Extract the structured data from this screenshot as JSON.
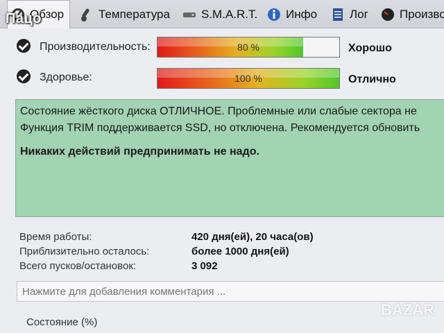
{
  "watermark": "Пацо",
  "tabs": [
    {
      "label": "Обзор",
      "icon": "gauge-icon"
    },
    {
      "label": "Температура",
      "icon": "thermometer-icon"
    },
    {
      "label": "S.M.A.R.T.",
      "icon": "drive-icon"
    },
    {
      "label": "Инфо",
      "icon": "info-icon"
    },
    {
      "label": "Лог",
      "icon": "document-icon"
    },
    {
      "label": "Произво",
      "icon": "speedometer-icon"
    }
  ],
  "status": {
    "performance": {
      "label": "Производительность:",
      "percent": 80,
      "percent_text": "80 %",
      "verdict": "Хорошо"
    },
    "health": {
      "label": "Здоровье:",
      "percent": 100,
      "percent_text": "100 %",
      "verdict": "Отлично"
    }
  },
  "message": {
    "line1": "Состояние жёсткого диска ОТЛИЧНОЕ. Проблемные или слабые сектора не",
    "line2": "Функция TRIM поддерживается SSD, но отключена. Рекомендуется обновить",
    "advice": "Никаких действий предпринимать не надо."
  },
  "info": {
    "uptime": {
      "label": "Время работы:",
      "value": "420 дня(ей), 20 часа(ов)"
    },
    "remaining": {
      "label": "Приблизительно осталось:",
      "value": "более 1000 дня(ей)"
    },
    "starts": {
      "label": "Всего пусков/остановок:",
      "value": "3 092"
    }
  },
  "comment_placeholder": "Нажмите для добавления комментария ...",
  "state_label": "Состояние (%)",
  "logo_text": "BAZAR",
  "colors": {
    "message_bg": "#a2d3b3",
    "bar_red": "#e01a1a",
    "bar_green": "#4fc82a"
  }
}
